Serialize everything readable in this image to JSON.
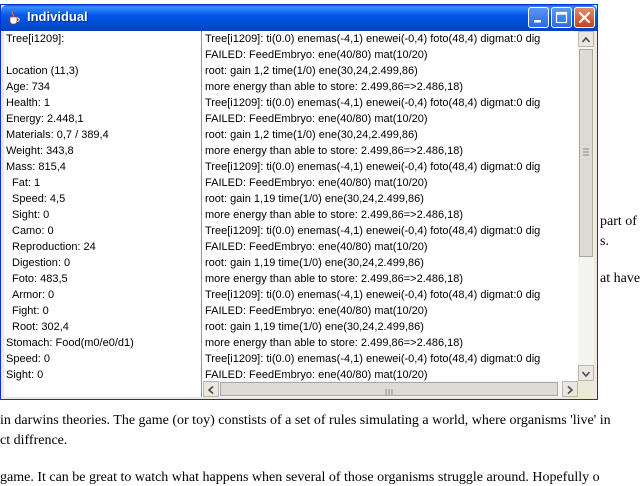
{
  "window": {
    "title": "Individual",
    "icon": "java-cup-icon"
  },
  "titlebar_buttons": [
    "minimize",
    "maximize",
    "close"
  ],
  "left_panel": [
    {
      "text": "Tree[i1209]:",
      "indent": false
    },
    {
      "text": "",
      "indent": false
    },
    {
      "text": "Location (11,3)",
      "indent": false
    },
    {
      "text": "Age: 734",
      "indent": false
    },
    {
      "text": "Health: 1",
      "indent": false
    },
    {
      "text": "Energy: 2.448,1",
      "indent": false
    },
    {
      "text": "Materials: 0,7 / 389,4",
      "indent": false
    },
    {
      "text": "Weight: 343,8",
      "indent": false
    },
    {
      "text": "Mass: 815,4",
      "indent": false
    },
    {
      "text": "Fat: 1",
      "indent": true
    },
    {
      "text": "Speed: 4,5",
      "indent": true
    },
    {
      "text": "Sight: 0",
      "indent": true
    },
    {
      "text": "Camo: 0",
      "indent": true
    },
    {
      "text": "Reproduction: 24",
      "indent": true
    },
    {
      "text": "Digestion: 0",
      "indent": true
    },
    {
      "text": "Foto: 483,5",
      "indent": true
    },
    {
      "text": "Armor: 0",
      "indent": true
    },
    {
      "text": "Fight: 0",
      "indent": true
    },
    {
      "text": "Root: 302,4",
      "indent": true
    },
    {
      "text": "Stomach: Food(m0/e0/d1)",
      "indent": false
    },
    {
      "text": "Speed: 0",
      "indent": false
    },
    {
      "text": "Sight: 0",
      "indent": false
    }
  ],
  "log_lines": [
    "Tree[i1209]: ti(0.0) enemas(-4,1) enewei(-0,4) foto(48,4) digmat:0 dig",
    "FAILED: FeedEmbryo: ene(40/80) mat(10/20)",
    "root: gain 1,2 time(1/0) ene(30,24,2.499,86)",
    "more energy than able to store: 2.499,86=>2.486,18)",
    "Tree[i1209]: ti(0.0) enemas(-4,1) enewei(-0,4) foto(48,4) digmat:0 dig",
    "FAILED: FeedEmbryo: ene(40/80) mat(10/20)",
    "root: gain 1,2 time(1/0) ene(30,24,2.499,86)",
    "more energy than able to store: 2.499,86=>2.486,18)",
    "Tree[i1209]: ti(0.0) enemas(-4,1) enewei(-0,4) foto(48,4) digmat:0 dig",
    "FAILED: FeedEmbryo: ene(40/80) mat(10/20)",
    "root: gain 1,19 time(1/0) ene(30,24,2.499,86)",
    "more energy than able to store: 2.499,86=>2.486,18)",
    "Tree[i1209]: ti(0.0) enemas(-4,1) enewei(-0,4) foto(48,4) digmat:0 dig",
    "FAILED: FeedEmbryo: ene(40/80) mat(10/20)",
    "root: gain 1,19 time(1/0) ene(30,24,2.499,86)",
    "more energy than able to store: 2.499,86=>2.486,18)",
    "Tree[i1209]: ti(0.0) enemas(-4,1) enewei(-0,4) foto(48,4) digmat:0 dig",
    "FAILED: FeedEmbryo: ene(40/80) mat(10/20)",
    "root: gain 1,19 time(1/0) ene(30,24,2.499,86)",
    "more energy than able to store: 2.499,86=>2.486,18)",
    "Tree[i1209]: ti(0.0) enemas(-4,1) enewei(-0,4) foto(48,4) digmat:0 dig",
    "FAILED: FeedEmbryo: ene(40/80) mat(10/20)"
  ],
  "background_page": {
    "right_fragments": [
      "part of",
      "s.",
      "at have"
    ],
    "bottom_lines": [
      "in darwins theories. The game (or toy) constists of a set of rules simulating a world, where organisms 'live' in",
      "ct diffrence.",
      "game. It can be great to watch what happens when several of those organisms struggle around. Hopefully o"
    ]
  },
  "colors": {
    "titlebar": "#0058e6",
    "window_frame": "#ece9d8",
    "close_button": "#c4401c"
  }
}
